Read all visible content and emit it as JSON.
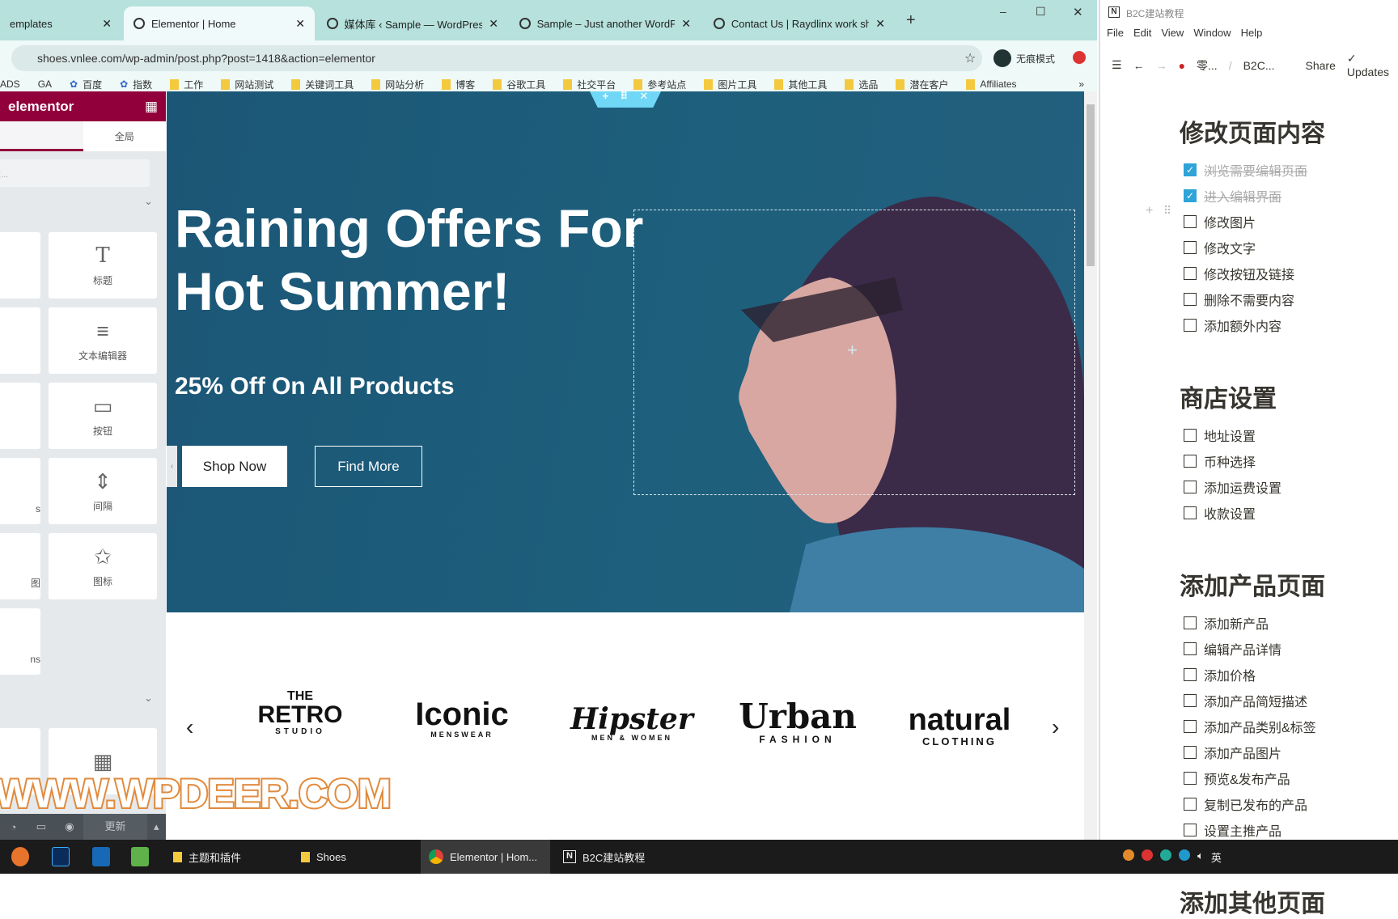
{
  "browser": {
    "tabs": [
      {
        "label": "emplates"
      },
      {
        "label": "Elementor | Home",
        "active": true
      },
      {
        "label": "媒体库 ‹ Sample — WordPress"
      },
      {
        "label": "Sample – Just another WordPr"
      },
      {
        "label": "Contact Us | Raydlinx work sh"
      }
    ],
    "new_tab": "+",
    "url": "shoes.vnlee.com/wp-admin/post.php?post=1418&action=elementor",
    "incognito": "无痕模式",
    "bookmarks": [
      "ADS",
      "GA",
      "百度",
      "指数",
      "工作",
      "网站测试",
      "关键词工具",
      "网站分析",
      "博客",
      "谷歌工具",
      "社交平台",
      "参考站点",
      "图片工具",
      "其他工具",
      "选品",
      "潜在客户",
      "Affiliates"
    ],
    "more": "»"
  },
  "elementor": {
    "logo": "elementor",
    "tab_global": "全局",
    "search_placeholder": "搜...",
    "widgets": [
      "标题",
      "文本编辑器",
      "按钮",
      "间隔",
      "图标"
    ],
    "partial_labels": [
      "s",
      "图",
      "ns"
    ],
    "update": "更新",
    "accent": "#92003b"
  },
  "hero": {
    "title_line1": "Raining Offers For",
    "title_line2": "Hot Summer!",
    "subtitle": "25% Off On All Products",
    "btn_shop": "Shop Now",
    "btn_find": "Find More",
    "bg": "#1d5a78"
  },
  "brands": [
    {
      "top": "THE",
      "main": "RETRO",
      "sub": "STUDIO"
    },
    {
      "main": "Iconic",
      "sub": "MENSWEAR"
    },
    {
      "main": "Hipster",
      "sub": "MEN & WOMEN"
    },
    {
      "main": "Urban",
      "sub": "FASHION"
    },
    {
      "main": "natural",
      "sub": "CLOTHING"
    }
  ],
  "watermark": "WWW.WPDEER.COM",
  "notion": {
    "title": "B2C建站教程",
    "menu": [
      "File",
      "Edit",
      "View",
      "Window",
      "Help"
    ],
    "breadcrumb": [
      "零...",
      "/",
      "B2C..."
    ],
    "share": "Share",
    "updates": "Updates",
    "sections": [
      {
        "heading": "修改页面内容",
        "items": [
          {
            "t": "浏览需要编辑页面",
            "done": true
          },
          {
            "t": "进入编辑界面",
            "done": true
          },
          {
            "t": "修改图片"
          },
          {
            "t": "修改文字"
          },
          {
            "t": "修改按钮及链接"
          },
          {
            "t": "删除不需要内容"
          },
          {
            "t": "添加额外内容"
          }
        ]
      },
      {
        "heading": "商店设置",
        "items": [
          {
            "t": "地址设置"
          },
          {
            "t": "币种选择"
          },
          {
            "t": "添加运费设置"
          },
          {
            "t": "收款设置"
          }
        ]
      },
      {
        "heading": "添加产品页面",
        "items": [
          {
            "t": "添加新产品"
          },
          {
            "t": "编辑产品详情"
          },
          {
            "t": "添加价格"
          },
          {
            "t": "添加产品简短描述"
          },
          {
            "t": "添加产品类别&标签"
          },
          {
            "t": "添加产品图片"
          },
          {
            "t": "预览&发布产品"
          },
          {
            "t": "复制已发布的产品"
          },
          {
            "t": "设置主推产品"
          }
        ]
      },
      {
        "heading": "添加其他页面",
        "items": []
      }
    ]
  },
  "taskbar": {
    "items": [
      "主题和插件",
      "Shoes",
      "Elementor | Hom...",
      "B2C建站教程"
    ],
    "ime": "英"
  }
}
